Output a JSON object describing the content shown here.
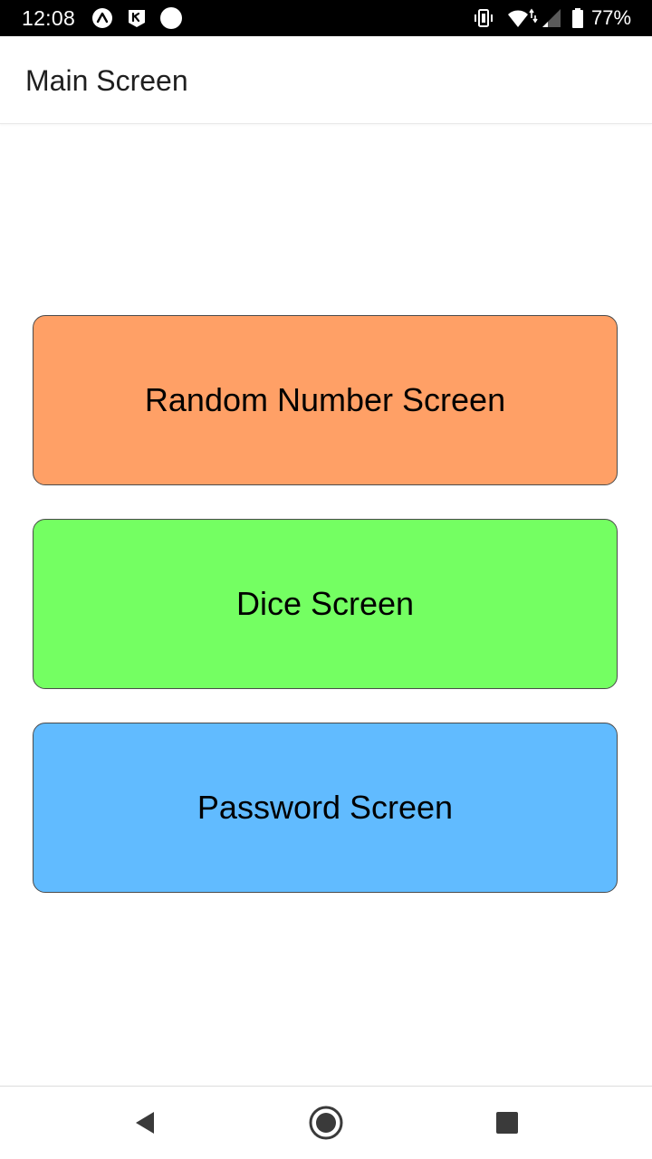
{
  "status_bar": {
    "time": "12:08",
    "battery_percent": "77%",
    "icons": [
      "expo-icon",
      "notification-app-icon",
      "record-dot-icon",
      "vibrate-icon",
      "wifi-icon",
      "cell-signal-icon",
      "battery-icon"
    ]
  },
  "app_bar": {
    "title": "Main Screen"
  },
  "buttons": [
    {
      "label": "Random Number Screen",
      "color": "#FFA066"
    },
    {
      "label": "Dice Screen",
      "color": "#74FF62"
    },
    {
      "label": "Password Screen",
      "color": "#61BBFF"
    }
  ],
  "nav_bar": {
    "icons": [
      "back-icon",
      "home-icon",
      "recents-icon"
    ]
  }
}
